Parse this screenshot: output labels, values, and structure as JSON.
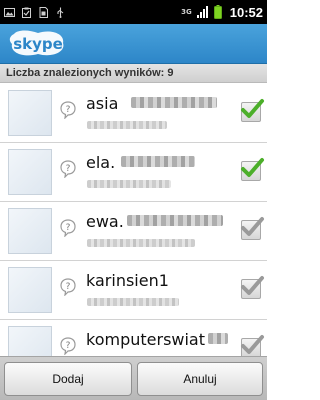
{
  "status_bar": {
    "left_icons": [
      "image-icon",
      "clipboard-check-icon",
      "sim-card-icon",
      "usb-icon"
    ],
    "network_type": "3G",
    "time": "10:52"
  },
  "header": {
    "logo_text": "skype"
  },
  "results": {
    "count_label": "Liczba znalezionych wyników: 9",
    "items": [
      {
        "name": "asia",
        "checked": true
      },
      {
        "name": "ela.",
        "checked": true
      },
      {
        "name": "ewa.",
        "checked": false
      },
      {
        "name": "karinsien1",
        "checked": false
      },
      {
        "name": "komputerswiat",
        "checked": false
      }
    ]
  },
  "actions": {
    "add_label": "Dodaj",
    "cancel_label": "Anuluj"
  },
  "colors": {
    "header_blue": "#2d86c8",
    "check_green": "#4caf2a",
    "check_gray": "#9a9a9a"
  }
}
